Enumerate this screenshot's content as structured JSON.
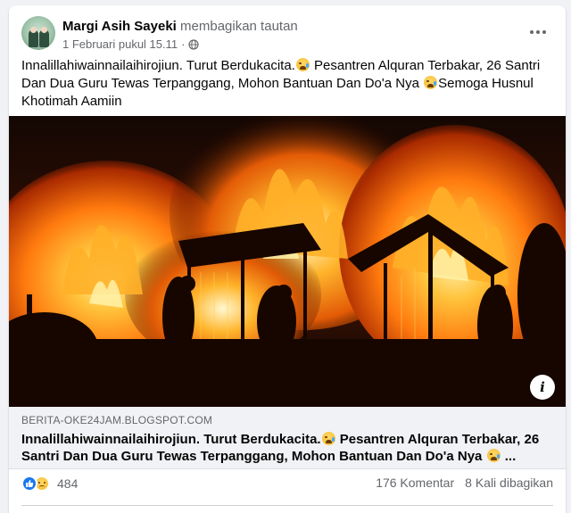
{
  "post": {
    "author": "Margi Asih Sayeki",
    "action": "membagikan tautan",
    "timestamp": "1 Februari pukul 15.11",
    "privacy_icon": "globe-icon",
    "text_parts": [
      "Innalillahiwainnailaihirojiun. Turut Berdukacita.",
      " Pesantren Alquran Terbakar, 26 Santri Dan Dua Guru Tewas Terpanggang, Mohon Bantuan Dan Do'a Nya ",
      "Semoga Husnul Khotimah Aamiin"
    ]
  },
  "link": {
    "domain": "BERITA-OKE24JAM.BLOGSPOT.COM",
    "title_parts": [
      "Innalillahiwainnailaihirojiun. Turut Berdukacita.",
      " Pesantren Alquran Terbakar, 26 Santri Dan Dua Guru Tewas Terpanggang, Mohon Bantuan Dan Do'a Nya ",
      " ..."
    ],
    "info_label": "i"
  },
  "stats": {
    "reaction_count": "484",
    "comments": "176 Komentar",
    "shares": "8 Kali dibagikan"
  },
  "colors": {
    "accent": "#1877f2",
    "secondary_text": "#65676b",
    "background": "#f0f2f5"
  }
}
